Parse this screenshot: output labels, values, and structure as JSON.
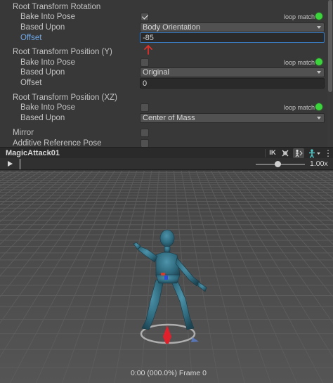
{
  "inspector": {
    "root_rotation": {
      "title": "Root Transform Rotation",
      "bake_label": "Bake Into Pose",
      "bake_checked": true,
      "loop_match": "loop match",
      "based_upon_label": "Based Upon",
      "based_upon_value": "Body Orientation",
      "offset_label": "Offset",
      "offset_value": "-85"
    },
    "root_position_y": {
      "title": "Root Transform Position (Y)",
      "bake_label": "Bake Into Pose",
      "bake_checked": false,
      "loop_match": "loop match",
      "based_upon_label": "Based Upon",
      "based_upon_value": "Original",
      "offset_label": "Offset",
      "offset_value": "0"
    },
    "root_position_xz": {
      "title": "Root Transform Position (XZ)",
      "bake_label": "Bake Into Pose",
      "bake_checked": false,
      "loop_match": "loop match",
      "based_upon_label": "Based Upon",
      "based_upon_value": "Center of Mass"
    },
    "mirror_label": "Mirror",
    "mirror_checked": false,
    "additive_label": "Additive Reference Pose",
    "additive_checked": false
  },
  "preview": {
    "clip_name": "MagicAttack01",
    "ik_label": "IK",
    "speed_value": "1.00x",
    "speed_fraction": 0.45,
    "frame_text": "0:00 (000.0%) Frame 0"
  },
  "colors": {
    "loop_match_dot": "#3bd43b",
    "character": "#2f6a7e",
    "active_border": "#3a79bb",
    "offset_label": "#6fa8e6"
  },
  "icons": {
    "play": "play-icon",
    "ik": "ik-toggle-icon",
    "pivot": "pivot-icon",
    "avatar": "avatar-icon",
    "avatar_select": "avatar-select-icon",
    "menu": "menu-icon",
    "up_arrow": "red-up-arrow-icon"
  }
}
